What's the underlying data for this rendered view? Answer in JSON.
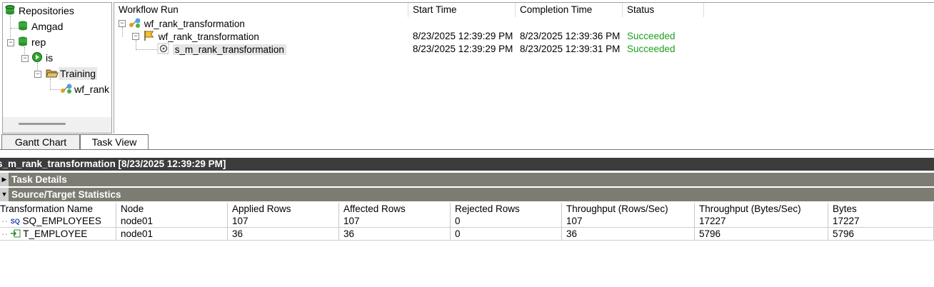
{
  "tree": {
    "items": [
      {
        "label": "Repositories",
        "icon": "repositories-icon"
      },
      {
        "label": "Amgad",
        "icon": "repository-icon"
      },
      {
        "label": "rep",
        "icon": "repository-icon"
      },
      {
        "label": "is",
        "icon": "integration-service-icon"
      },
      {
        "label": "Training",
        "icon": "folder-icon"
      },
      {
        "label": "wf_rank",
        "icon": "workflow-icon"
      }
    ]
  },
  "workflow_list": {
    "columns": [
      "Workflow Run",
      "Start Time",
      "Completion Time",
      "Status"
    ],
    "rows": [
      {
        "name": "wf_rank_transformation",
        "start": "",
        "end": "",
        "status": ""
      },
      {
        "name": "wf_rank_transformation",
        "start": "8/23/2025 12:39:29 PM",
        "end": "8/23/2025 12:39:36 PM",
        "status": "Succeeded"
      },
      {
        "name": "s_m_rank_transformation",
        "start": "8/23/2025 12:39:29 PM",
        "end": "8/23/2025 12:39:31 PM",
        "status": "Succeeded"
      }
    ]
  },
  "tabs": [
    "Gantt Chart",
    "Task View"
  ],
  "details": {
    "title": "s_m_rank_transformation [8/23/2025 12:39:29 PM]",
    "sections": [
      "Task Details",
      "Source/Target Statistics"
    ]
  },
  "stats": {
    "columns": [
      "Transformation Name",
      "Node",
      "Applied Rows",
      "Affected Rows",
      "Rejected Rows",
      "Throughput (Rows/Sec)",
      "Throughput (Bytes/Sec)",
      "Bytes"
    ],
    "rows": [
      {
        "name": "SQ_EMPLOYEES",
        "node": "node01",
        "applied": "107",
        "affected": "107",
        "rejected": "0",
        "tp_rows": "107",
        "tp_bytes": "17227",
        "bytes": "17227"
      },
      {
        "name": "T_EMPLOYEE",
        "node": "node01",
        "applied": "36",
        "affected": "36",
        "rejected": "0",
        "tp_rows": "36",
        "tp_bytes": "5796",
        "bytes": "5796"
      }
    ]
  },
  "colors": {
    "success": "#1ea01e",
    "title_bar": "#3c3c3c",
    "section_bar": "#7d7c72"
  }
}
